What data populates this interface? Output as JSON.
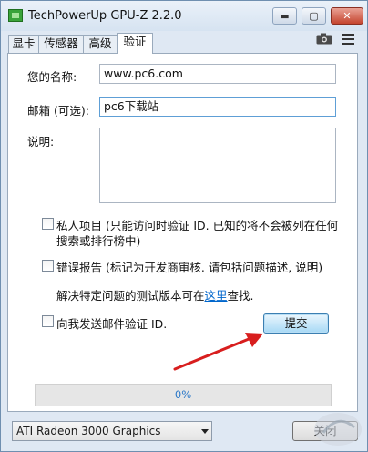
{
  "window": {
    "title": "TechPowerUp GPU-Z 2.2.0",
    "minimize_symbol": "▬",
    "maximize_symbol": "▢",
    "close_symbol": "✕"
  },
  "tabs": [
    {
      "label": "显卡",
      "active": false
    },
    {
      "label": "传感器",
      "active": false
    },
    {
      "label": "高级",
      "active": false
    },
    {
      "label": "验证",
      "active": true
    }
  ],
  "toolbar_icons": [
    "camera-icon",
    "hamburger-menu-icon"
  ],
  "form": {
    "name_label": "您的名称:",
    "name_value": "www.pc6.com",
    "email_label": "邮箱 (可选):",
    "email_value": "pc6下载站",
    "description_label": "说明:",
    "description_value": ""
  },
  "options": {
    "private_label_line1": "私人项目 (只能访问时验证 ID. 已知的将不会被列在任何",
    "private_label_line2": "搜索或排行榜中)",
    "private_checked": false,
    "bug_report_label": "错误报告 (标记为开发商审核. 请包括问题描述, 说明)",
    "bug_report_checked": false,
    "beta_note_prefix": "解决特定问题的测试版本可在",
    "beta_note_link": "这里",
    "beta_note_suffix": "查找.",
    "email_id_label": "向我发送邮件验证 ID.",
    "email_id_checked": false
  },
  "submit_label": "提交",
  "progress": {
    "value": 0,
    "text": "0%"
  },
  "footer": {
    "gpu_selected": "ATI Radeon 3000 Graphics",
    "close_label": "关闭"
  },
  "colors": {
    "accent": "#2b78c8",
    "annotation_arrow": "#d81e1e",
    "close_button": "#c5452f"
  }
}
